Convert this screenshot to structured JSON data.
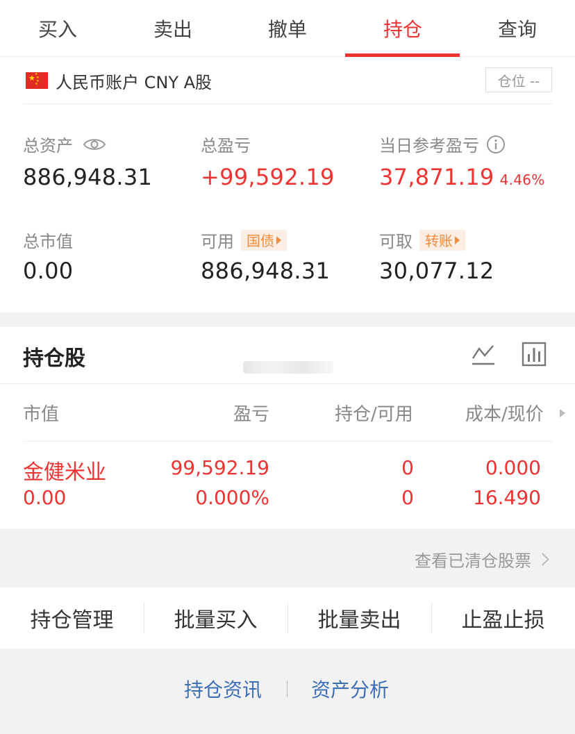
{
  "tabs": [
    {
      "label": "买入"
    },
    {
      "label": "卖出"
    },
    {
      "label": "撤单"
    },
    {
      "label": "持仓"
    },
    {
      "label": "查询"
    }
  ],
  "active_tab": "持仓",
  "account": {
    "label": "人民币账户 CNY A股",
    "position_button": "仓位 --",
    "flag_icon": "china-flag-icon"
  },
  "summary": {
    "total_assets_label": "总资产",
    "total_assets_value": "886,948.31",
    "total_pl_label": "总盈亏",
    "total_pl_value": "+99,592.19",
    "daily_pl_label": "当日参考盈亏",
    "daily_pl_value": "37,871.19",
    "daily_pl_pct": "4.46%",
    "market_value_label": "总市值",
    "market_value_value": "0.00",
    "available_label": "可用",
    "available_tag": "国债",
    "available_value": "886,948.31",
    "withdrawable_label": "可取",
    "withdrawable_tag": "转账",
    "withdrawable_value": "30,077.12"
  },
  "holdings": {
    "title": "持仓股",
    "headers": [
      "市值",
      "盈亏",
      "持仓/可用",
      "成本/现价"
    ],
    "rows": [
      {
        "name": "金健米业",
        "market_value": "0.00",
        "pl": "99,592.19",
        "pl_pct": "0.000%",
        "position": "0",
        "available": "0",
        "cost": "0.000",
        "price": "16.490"
      }
    ],
    "view_cleared": "查看已清仓股票"
  },
  "actions": [
    {
      "label": "持仓管理"
    },
    {
      "label": "批量买入"
    },
    {
      "label": "批量卖出"
    },
    {
      "label": "止盈止损"
    }
  ],
  "footer": {
    "news": "持仓资讯",
    "analysis": "资产分析"
  },
  "colors": {
    "accent_red": "#e33",
    "tag_orange": "#f08a3c",
    "link_blue": "#3d6fb6"
  }
}
